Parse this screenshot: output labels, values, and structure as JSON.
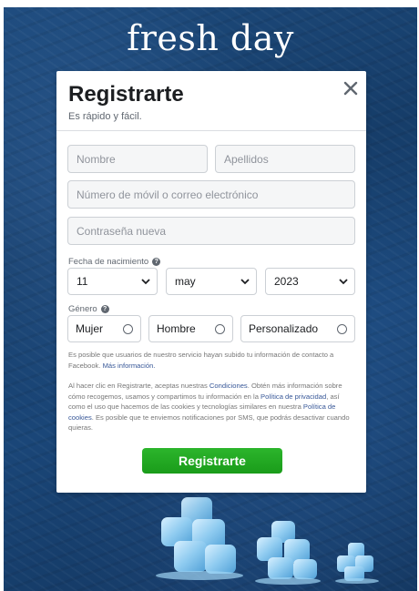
{
  "brand": {
    "name": "fresh day"
  },
  "dialog": {
    "title": "Registrarte",
    "subtitle": "Es rápido y fácil.",
    "fields": {
      "first_name_placeholder": "Nombre",
      "last_name_placeholder": "Apellidos",
      "contact_placeholder": "Número de móvil o correo electrónico",
      "password_placeholder": "Contraseña nueva"
    },
    "birthday": {
      "label": "Fecha de nacimiento",
      "day": "11",
      "month": "may",
      "year": "2023"
    },
    "gender": {
      "label": "Género",
      "options": [
        "Mujer",
        "Hombre",
        "Personalizado"
      ]
    },
    "notice_contacts": {
      "text": "Es posible que usuarios de nuestro servicio hayan subido tu información de contacto a Facebook.",
      "link": "Más información."
    },
    "terms": {
      "part1": "Al hacer clic en Registrarte, aceptas nuestras",
      "link_terms": "Condiciones",
      "part2": ". Obtén más información sobre cómo recogemos, usamos y compartimos tu información en la",
      "link_privacy": "Política de privacidad",
      "part3": ", así como el uso que hacemos de las cookies y tecnologías similares en nuestra",
      "link_cookies": "Política de cookies",
      "part4": ". Es posible que te enviemos notificaciones por SMS, que podrás desactivar cuando quieras."
    },
    "submit_label": "Registrarte"
  },
  "icons": {
    "close": "close-icon",
    "help": "help-icon",
    "chevron": "chevron-down-icon",
    "ice": "ice-cubes-illustration"
  },
  "colors": {
    "background": "#1a4678",
    "submit": "#1fa51f",
    "link": "#385898",
    "brand_text": "#ffffff"
  }
}
